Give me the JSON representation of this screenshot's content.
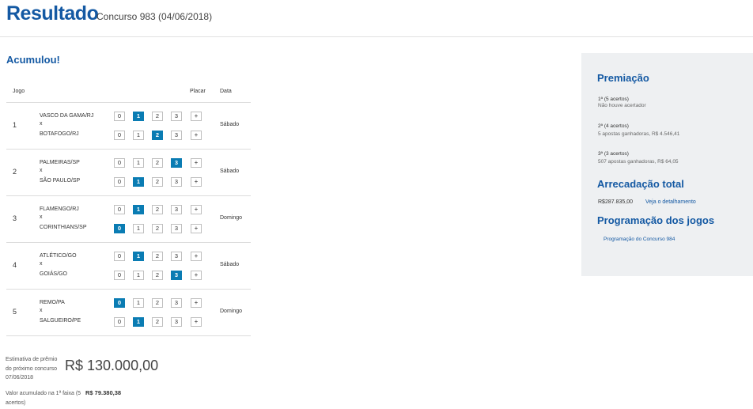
{
  "header": {
    "title": "Resultado",
    "subtitle": "Concurso 983 (04/06/2018)"
  },
  "status": "Acumulou!",
  "table": {
    "headers": {
      "game": "Jogo",
      "score": "Placar",
      "date": "Data"
    },
    "options": [
      "0",
      "1",
      "2",
      "3",
      "+"
    ],
    "games": [
      {
        "num": "1",
        "home": "VASCO DA GAMA/RJ",
        "sep": "x",
        "away": "BOTAFOGO/RJ",
        "home_pick": "1",
        "away_pick": "2",
        "day": "Sábado"
      },
      {
        "num": "2",
        "home": "PALMEIRAS/SP",
        "sep": "x",
        "away": "SÃO PAULO/SP",
        "home_pick": "3",
        "away_pick": "1",
        "day": "Sábado"
      },
      {
        "num": "3",
        "home": "FLAMENGO/RJ",
        "sep": "x",
        "away": "CORINTHIANS/SP",
        "home_pick": "1",
        "away_pick": "0",
        "day": "Domingo"
      },
      {
        "num": "4",
        "home": "ATLÉTICO/GO",
        "sep": "x",
        "away": "GOIÁS/GO",
        "home_pick": "1",
        "away_pick": "3",
        "day": "Sábado"
      },
      {
        "num": "5",
        "home": "REMO/PA",
        "sep": "x",
        "away": "SALGUEIRO/PE",
        "home_pick": "0",
        "away_pick": "1",
        "day": "Domingo"
      }
    ]
  },
  "estimate": {
    "label": "Estimativa de prêmio do próximo concurso 07/06/2018",
    "value": "R$ 130.000,00"
  },
  "accumulated": {
    "label": "Valor acumulado na 1ª faixa (5 acertos)",
    "value": "R$ 79.380,38"
  },
  "sidebar": {
    "prize_title": "Premiação",
    "tiers": [
      {
        "title": "1ª (5 acertos)",
        "text": "Não houve acertador"
      },
      {
        "title": "2ª (4 acertos)",
        "text": "5 apostas ganhadoras, R$ 4.546,41"
      },
      {
        "title": "3ª (3 acertos)",
        "text": "507 apostas ganhadoras, R$ 64,05"
      }
    ],
    "total_title": "Arrecadação total",
    "total_value": "R$287.835,00",
    "detail_link": "Veja o detalhamento",
    "schedule_title": "Programação dos jogos",
    "schedule_link": "Programação do Concurso 984"
  }
}
